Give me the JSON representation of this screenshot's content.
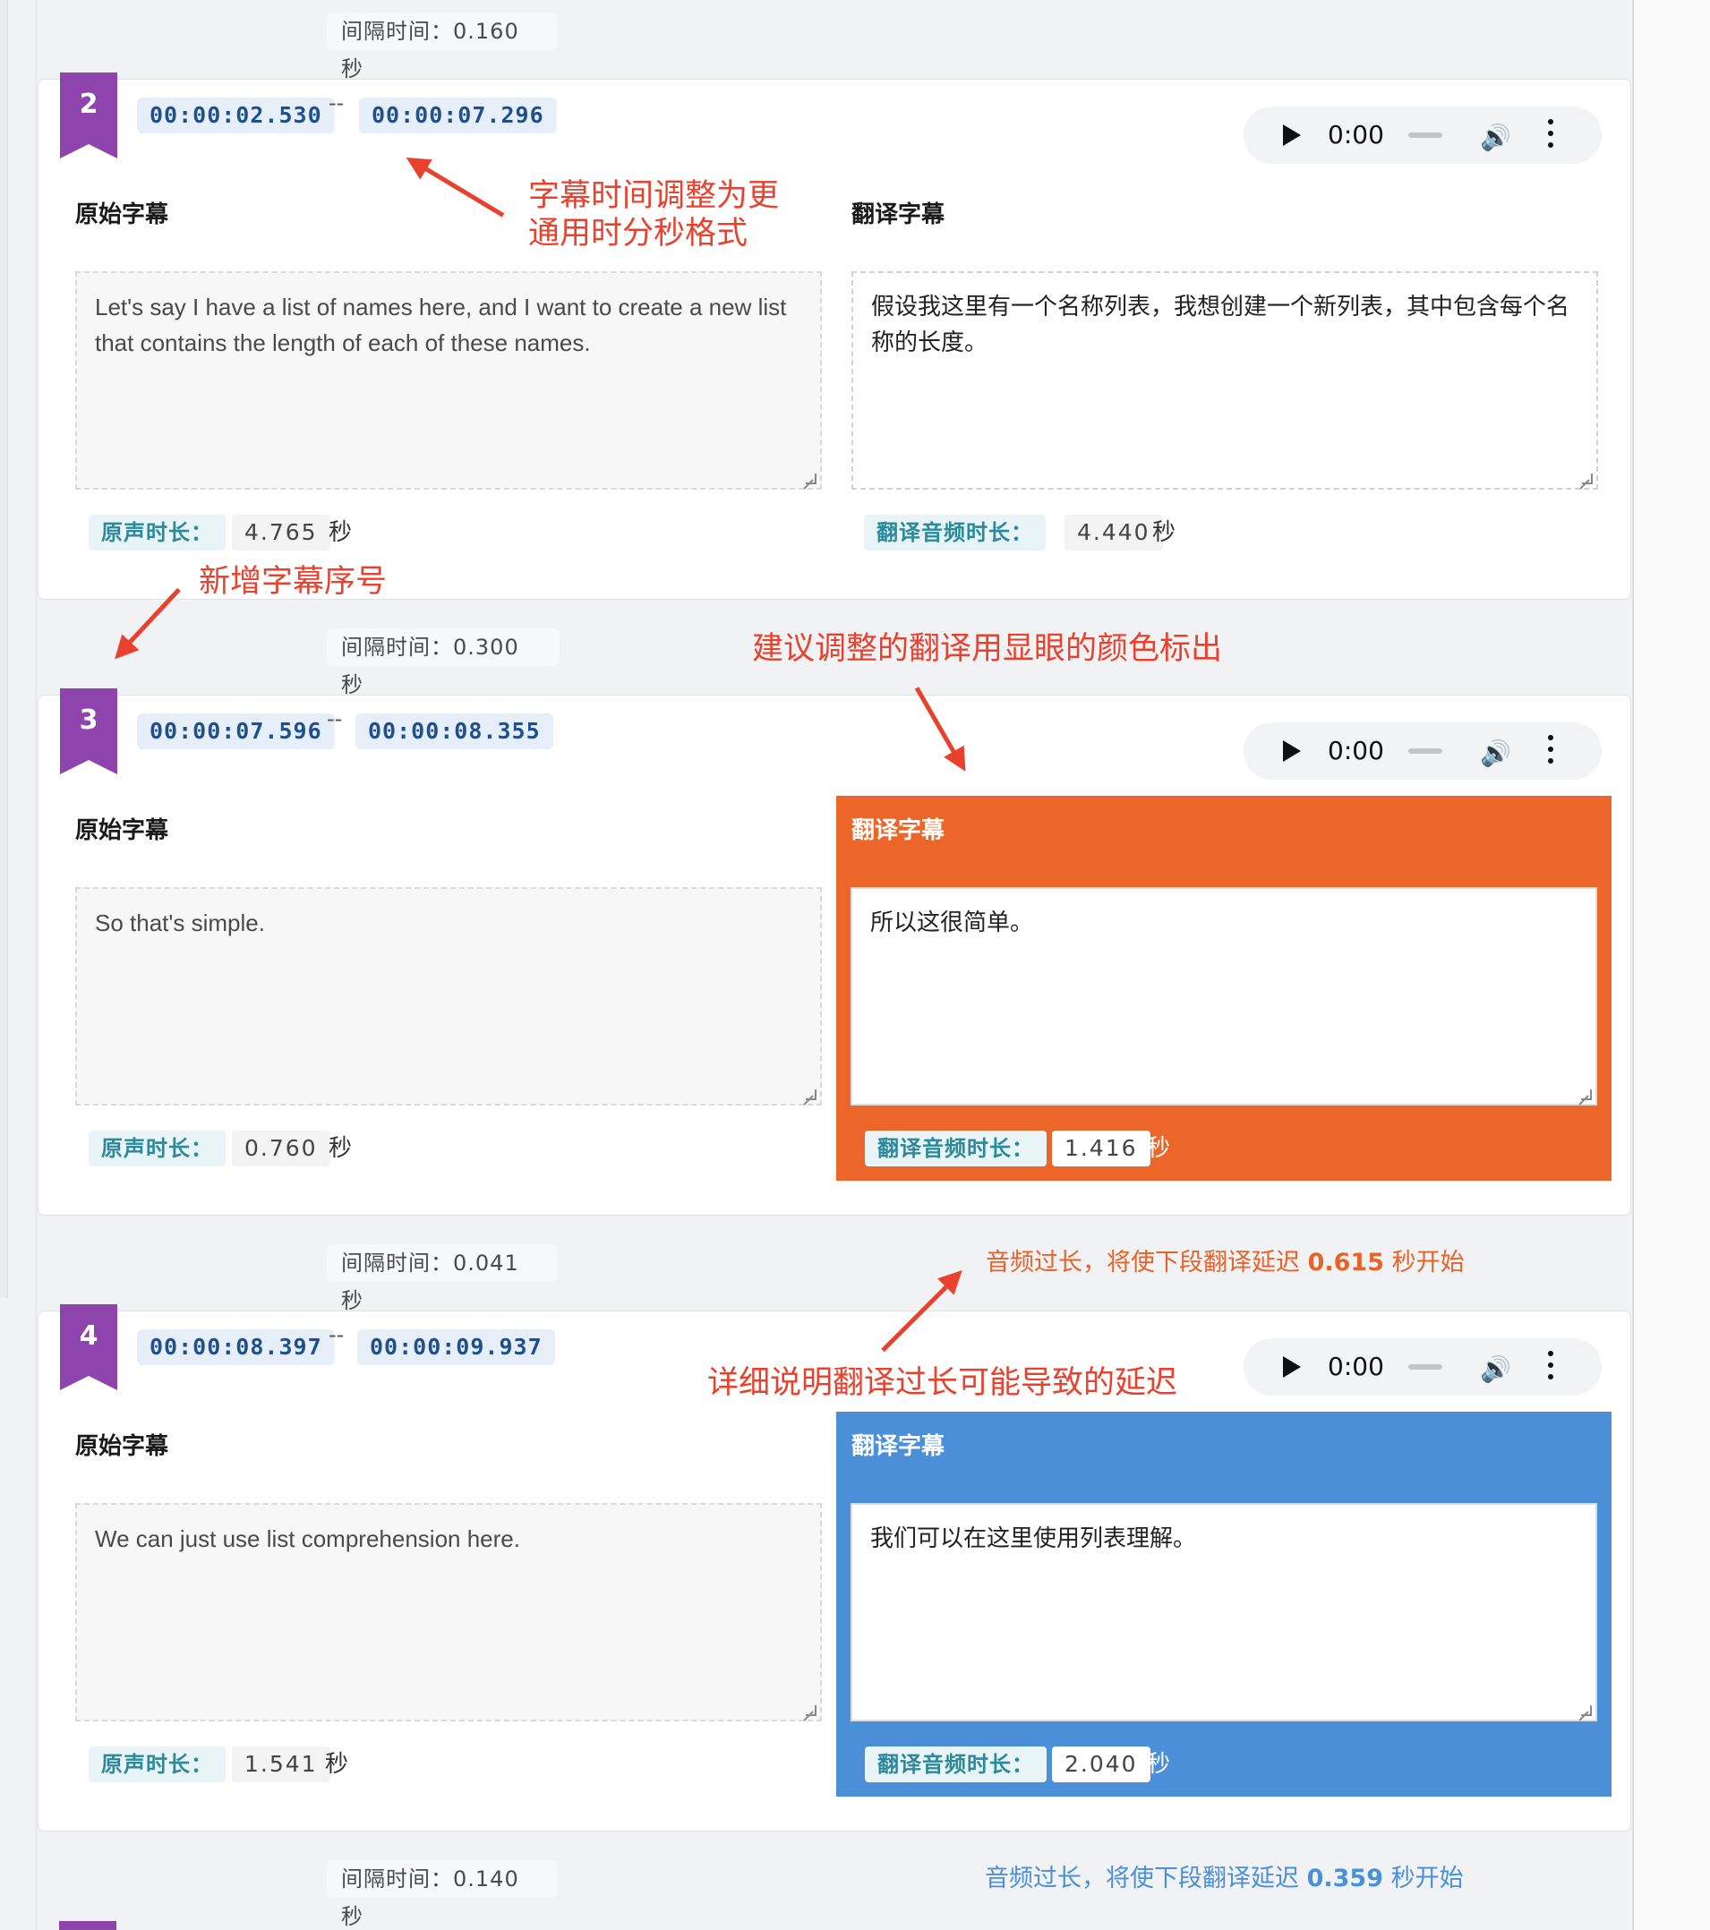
{
  "gap_label": "间隔时间：",
  "sec_unit": "秒",
  "gaps": [
    {
      "value": "0.160",
      "unit": "秒"
    },
    {
      "value": "0.300",
      "unit": "秒"
    },
    {
      "value": "0.041",
      "unit": "秒"
    },
    {
      "value": "0.140",
      "unit": "秒"
    }
  ],
  "warnings": [
    {
      "prefix": "音频过长，将使下段翻译延迟 ",
      "value": "0.615",
      "suffix": " 秒开始",
      "color": "#e8632a"
    },
    {
      "prefix": "音频过长，将使下段翻译延迟 ",
      "value": "0.359",
      "suffix": " 秒开始",
      "color": "#4a90d9"
    }
  ],
  "labels": {
    "original": "原始字幕",
    "translated": "翻译字幕",
    "orig_dur": "原声时长：",
    "trans_dur": "翻译音频时长："
  },
  "player": {
    "time": "0:00"
  },
  "cards": [
    {
      "index": "2",
      "start": "00:00:02.530",
      "sep": "--",
      "end": "00:00:07.296",
      "original": "Let's say I have a list of names here, and I want to create a new list that contains the length of each of these names.",
      "translated": "假设我这里有一个名称列表，我想创建一个新列表，其中包含每个名称的长度。",
      "orig_dur": "4.765",
      "trans_dur": "4.440",
      "highlight": "none"
    },
    {
      "index": "3",
      "start": "00:00:07.596",
      "sep": "--",
      "end": "00:00:08.355",
      "original": "So that's simple.",
      "translated": "所以这很简单。",
      "orig_dur": "0.760",
      "trans_dur": "1.416",
      "highlight": "#ec6629"
    },
    {
      "index": "4",
      "start": "00:00:08.397",
      "sep": "--",
      "end": "00:00:09.937",
      "original": "We can just use list comprehension here.",
      "translated": "我们可以在这里使用列表理解。",
      "orig_dur": "1.541",
      "trans_dur": "2.040",
      "highlight": "#4a8fd8"
    }
  ],
  "annotations": [
    {
      "text": "字幕时间调整为更通用时分秒格式"
    },
    {
      "text": "新增字幕序号"
    },
    {
      "text": "建议调整的翻译用显眼的颜色标出"
    },
    {
      "text": "详细说明翻译过长可能导致的延迟"
    }
  ],
  "colors": {
    "ribbon": "#8e44ad",
    "annotation": "#e8422e",
    "timecode": "#1d4f91"
  }
}
